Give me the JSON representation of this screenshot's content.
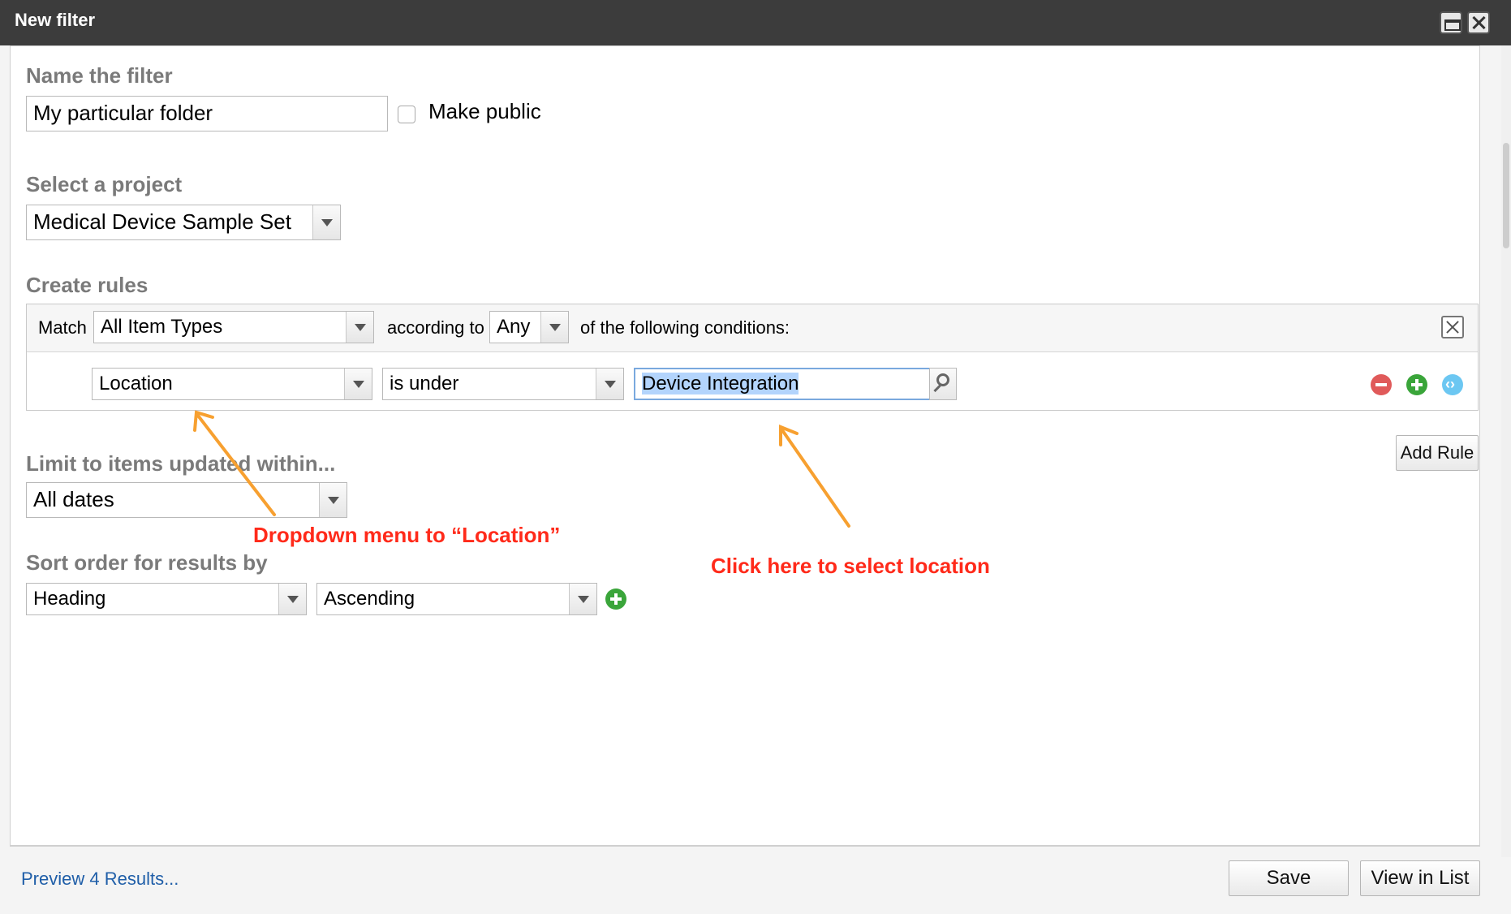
{
  "window": {
    "title": "New filter"
  },
  "name_section": {
    "label": "Name the filter",
    "value": "My particular folder",
    "make_public_label": "Make public"
  },
  "project_section": {
    "label": "Select a project",
    "value": "Medical Device Sample Set"
  },
  "rules_section": {
    "label": "Create rules",
    "match_label": "Match",
    "match_value": "All Item Types",
    "according_label": "according to",
    "according_value": "Any",
    "conditions_label": "of the following conditions:",
    "rule": {
      "field": "Location",
      "operator": "is under",
      "value": "Device Integration"
    },
    "add_rule": "Add Rule"
  },
  "limit_section": {
    "label": "Limit to items updated within...",
    "value": "All dates"
  },
  "sort_section": {
    "label": "Sort order for results by",
    "field": "Heading",
    "order": "Ascending"
  },
  "annotations": {
    "dropdown_note": "Dropdown menu to “Location”",
    "click_note": "Click here to select location"
  },
  "footer": {
    "preview_link": "Preview 4 Results...",
    "save": "Save",
    "view_in_list": "View in List"
  },
  "colors": {
    "titlebar": "#3c3c3c",
    "annotation_text": "#ff2a1a",
    "arrow": "#f7a030",
    "link": "#1f5ea8",
    "selection": "#b3d4fc"
  }
}
